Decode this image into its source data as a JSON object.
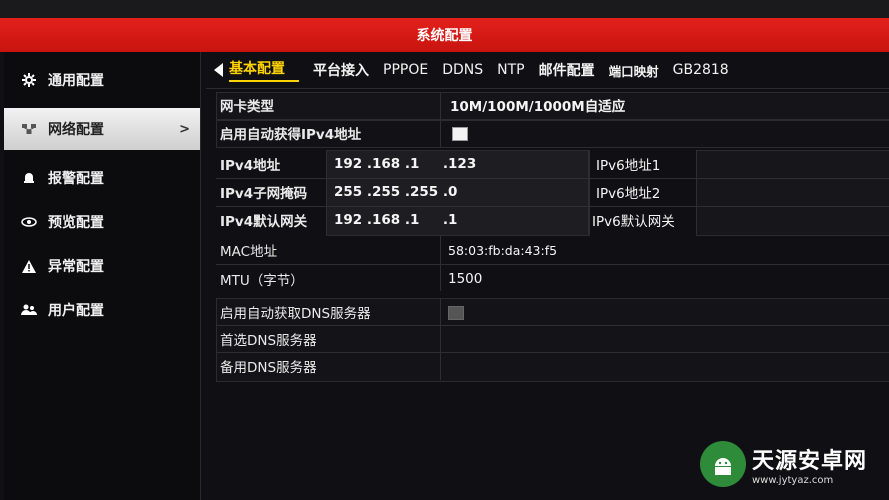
{
  "window": {
    "title": "系统配置"
  },
  "sidebar": {
    "items": [
      {
        "label": "通用配置",
        "icon": "gear-icon"
      },
      {
        "label": "网络配置",
        "icon": "network-icon",
        "active": true,
        "chevron": ">"
      },
      {
        "label": "报警配置",
        "icon": "alarm-icon"
      },
      {
        "label": "预览配置",
        "icon": "eye-icon"
      },
      {
        "label": "异常配置",
        "icon": "warning-icon"
      },
      {
        "label": "用户配置",
        "icon": "users-icon"
      }
    ]
  },
  "tabs": [
    {
      "label": "基本配置",
      "active": true
    },
    {
      "label": "平台接入"
    },
    {
      "label": "PPPOE"
    },
    {
      "label": "DDNS"
    },
    {
      "label": "NTP"
    },
    {
      "label": "邮件配置"
    },
    {
      "label": "端口映射"
    },
    {
      "label": "GB2818"
    }
  ],
  "form": {
    "nic_type": {
      "label": "网卡类型",
      "value": "10M/100M/1000M自适应"
    },
    "dhcp_ipv4": {
      "label": "启用自动获得IPv4地址",
      "checked": true
    },
    "ipv4_addr": {
      "label": "IPv4地址",
      "value": "192 .168 .1     .123"
    },
    "ipv4_mask": {
      "label": "IPv4子网掩码",
      "value": "255 .255 .255 .0"
    },
    "ipv4_gw": {
      "label": "IPv4默认网关",
      "value": "192 .168 .1     .1"
    },
    "ipv6_addr1": {
      "label": "IPv6地址1",
      "value": ""
    },
    "ipv6_addr2": {
      "label": "IPv6地址2",
      "value": ""
    },
    "ipv6_gw": {
      "label": "IPv6默认网关",
      "value": ""
    },
    "mac": {
      "label": "MAC地址",
      "value": "58:03:fb:da:43:f5"
    },
    "mtu": {
      "label": "MTU（字节）",
      "value": "1500"
    },
    "dhcp_dns": {
      "label": "启用自动获取DNS服务器",
      "checked": false
    },
    "dns1": {
      "label": "首选DNS服务器",
      "value": ""
    },
    "dns2": {
      "label": "备用DNS服务器",
      "value": ""
    }
  },
  "watermark": {
    "title": "天源安卓网",
    "url": "www.jytyaz.com"
  },
  "colors": {
    "titlebar": "#d4170f",
    "active_tab": "#ffd200"
  }
}
